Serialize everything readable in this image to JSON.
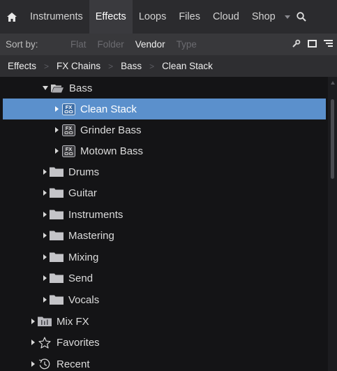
{
  "tabs": {
    "home_icon": "home-icon",
    "items": [
      {
        "label": "Instruments",
        "active": false
      },
      {
        "label": "Effects",
        "active": true
      },
      {
        "label": "Loops",
        "active": false
      },
      {
        "label": "Files",
        "active": false
      },
      {
        "label": "Cloud",
        "active": false
      },
      {
        "label": "Shop",
        "active": false
      }
    ],
    "more_icon": "chevron-down-icon",
    "search_icon": "search-icon"
  },
  "sort": {
    "label": "Sort by:",
    "options": [
      {
        "label": "Flat",
        "active": false
      },
      {
        "label": "Folder",
        "active": false
      },
      {
        "label": "Vendor",
        "active": true
      },
      {
        "label": "Type",
        "active": false
      }
    ]
  },
  "breadcrumb": [
    "Effects",
    "FX Chains",
    "Bass",
    "Clean Stack"
  ],
  "tree": {
    "bass": {
      "label": "Bass",
      "expanded": true
    },
    "presets": [
      {
        "label": "Clean Stack",
        "selected": true
      },
      {
        "label": "Grinder Bass",
        "selected": false
      },
      {
        "label": "Motown Bass",
        "selected": false
      }
    ],
    "folders": [
      {
        "label": "Drums"
      },
      {
        "label": "Guitar"
      },
      {
        "label": "Instruments"
      },
      {
        "label": "Mastering"
      },
      {
        "label": "Mixing"
      },
      {
        "label": "Send"
      },
      {
        "label": "Vocals"
      }
    ],
    "root": [
      {
        "label": "Mix FX",
        "icon": "mixfx-folder-icon"
      },
      {
        "label": "Favorites",
        "icon": "star-icon"
      },
      {
        "label": "Recent",
        "icon": "clock-icon"
      }
    ]
  },
  "colors": {
    "selection": "#5b90cc",
    "background": "#141416",
    "tabbar": "#2b2b2e",
    "active_tab": "#3a3a3e"
  }
}
